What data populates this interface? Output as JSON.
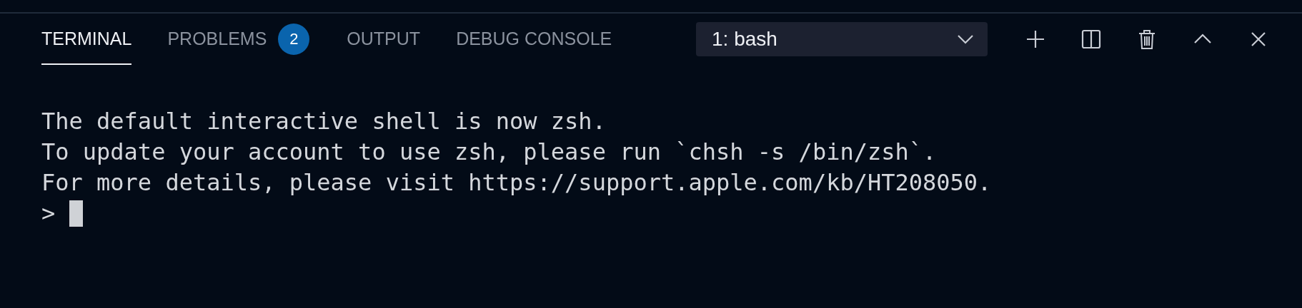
{
  "tabs": [
    {
      "label": "TERMINAL",
      "selected": true
    },
    {
      "label": "PROBLEMS",
      "selected": false,
      "badge": "2"
    },
    {
      "label": "OUTPUT",
      "selected": false
    },
    {
      "label": "DEBUG CONSOLE",
      "selected": false
    }
  ],
  "terminal_select": {
    "value": "1: bash"
  },
  "toolbar": [
    {
      "kind": "plus"
    },
    {
      "kind": "split"
    },
    {
      "kind": "trash"
    },
    {
      "kind": "up"
    },
    {
      "kind": "close"
    }
  ],
  "terminal": {
    "lines": [
      "The default interactive shell is now zsh.",
      "To update your account to use zsh, please run `chsh -s /bin/zsh`.",
      "For more details, please visit https://support.apple.com/kb/HT208050."
    ],
    "prompt": ">"
  }
}
